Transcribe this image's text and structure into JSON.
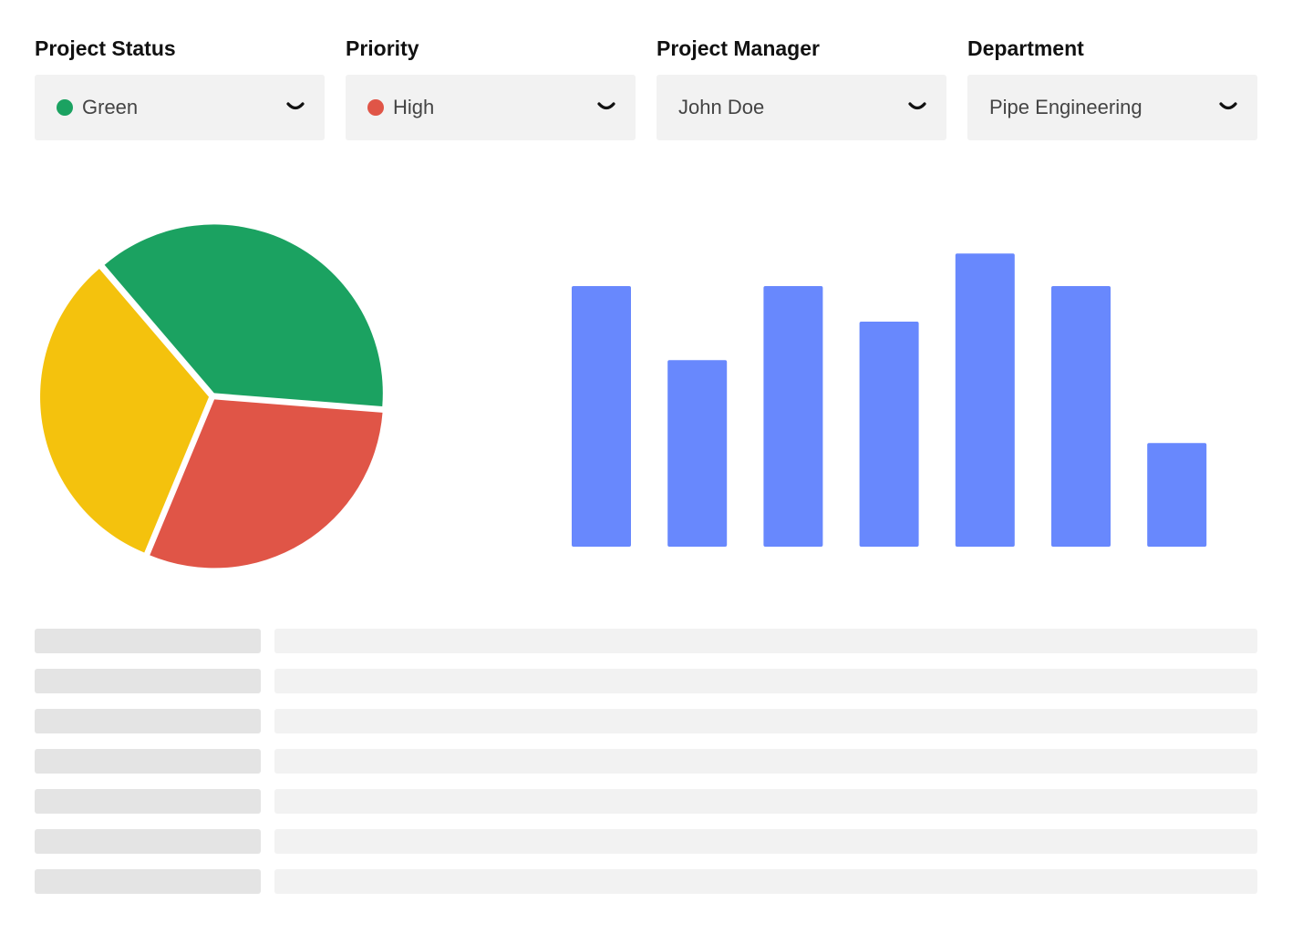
{
  "filters": [
    {
      "label": "Project Status",
      "value": "Green",
      "dot_color": "#1ba261"
    },
    {
      "label": "Priority",
      "value": "High",
      "dot_color": "#e05547"
    },
    {
      "label": "Project Manager",
      "value": "John Doe",
      "dot_color": null
    },
    {
      "label": "Department",
      "value": "Pipe Engineering",
      "dot_color": null
    }
  ],
  "icons": {
    "dropdown": "chevron-down-icon",
    "status_indicator": "status-dot-icon"
  },
  "chart_data": [
    {
      "type": "pie",
      "title": "",
      "legend": "none",
      "slices": [
        {
          "value": 0.375,
          "color": "#1ba261"
        },
        {
          "value": 0.3,
          "color": "#e05547"
        },
        {
          "value": 0.325,
          "color": "#f4c20d"
        }
      ]
    },
    {
      "type": "bar",
      "title": "",
      "xlabel": "",
      "ylabel": "",
      "grid": false,
      "legend": "none",
      "ylim": [
        0,
        100
      ],
      "color": "#6888fd",
      "values": [
        88,
        63,
        88,
        76,
        99,
        88,
        35
      ]
    }
  ],
  "table_placeholder": {
    "rows": 7,
    "colors": {
      "label_cell": "#e4e4e4",
      "value_cell": "#f2f2f2"
    }
  }
}
